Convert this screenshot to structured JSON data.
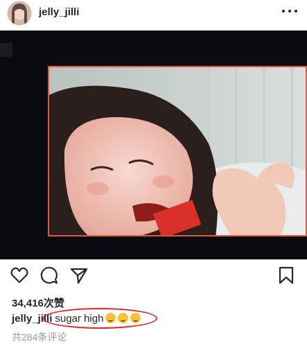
{
  "post": {
    "username": "jelly_jilli",
    "likes": "34,416次赞",
    "caption_user": "jelly_jilli",
    "caption_text": "sugar high",
    "caption_emojis": [
      "rofl-emoji",
      "rofl-emoji",
      "rofl-emoji"
    ],
    "comments_link": "共284条评论"
  },
  "icons": {
    "more": "more-horizontal-icon",
    "like": "heart-icon",
    "comment": "comment-bubble-icon",
    "share": "paper-plane-icon",
    "save": "bookmark-icon"
  },
  "colors": {
    "frame_border": "#e8563a",
    "annotation": "#e0252b",
    "media_bg": "#0a0b10"
  }
}
